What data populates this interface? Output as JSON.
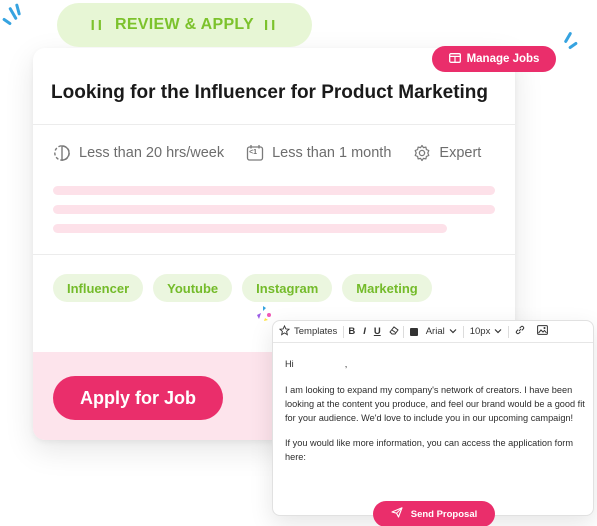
{
  "header_pill": {
    "left_bars": "II",
    "label": "REVIEW & APPLY",
    "right_bars": "II"
  },
  "manage_jobs": {
    "label": "Manage Jobs"
  },
  "job": {
    "title": "Looking for the Influencer for Product Marketing",
    "meta": {
      "hours": "Less than 20 hrs/week",
      "duration_icon_text": "<1",
      "duration": "Less than 1 month",
      "level": "Expert"
    },
    "tags": [
      "Influencer",
      "Youtube",
      "Instagram",
      "Marketing"
    ],
    "apply_label": "Apply for Job"
  },
  "editor": {
    "toolbar": {
      "templates": "Templates",
      "bold": "B",
      "italic": "I",
      "underline": "U",
      "font": "Arial",
      "size": "10px"
    },
    "greeting": "Hi                    ,",
    "paragraph1": "I am looking to expand my company's network of creators. I have been looking at the content you produce, and feel our brand would be a good fit for your audience. We'd love to include you in our upcoming campaign!",
    "paragraph2": "If you would like more information, you can access the application form here:",
    "send_label": "Send Proposal"
  },
  "colors": {
    "accent": "#ea2e6b",
    "green": "#7cc22c",
    "pink_light": "#fde4ec",
    "spark_blue": "#36a3e0"
  }
}
